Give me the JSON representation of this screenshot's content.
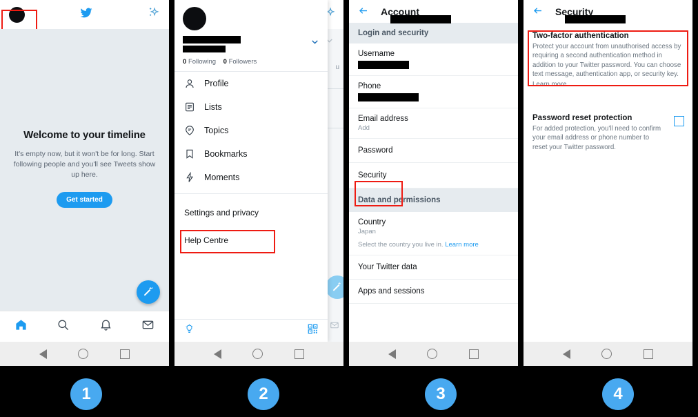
{
  "panel1": {
    "name": "twitter-timeline",
    "topbar": {
      "avatar": "avatar",
      "logo": "twitter-bird-icon",
      "sparkle": "sparkle-icon"
    },
    "empty_state": {
      "title": "Welcome to your timeline",
      "body": "It's empty now, but it won't be for long. Start following people and you'll see Tweets show up here.",
      "button": "Get started"
    },
    "tabs": [
      {
        "name": "home",
        "icon": "home-icon",
        "active": true
      },
      {
        "name": "search",
        "icon": "search-icon",
        "active": false
      },
      {
        "name": "notifications",
        "icon": "bell-icon",
        "active": false
      },
      {
        "name": "messages",
        "icon": "envelope-icon",
        "active": false
      }
    ],
    "compose": "compose-tweet-icon"
  },
  "panel2": {
    "name": "navigation-drawer",
    "profile": {
      "following_count": "0",
      "following_label": "Following",
      "followers_count": "0",
      "followers_label": "Followers"
    },
    "items": [
      {
        "label": "Profile",
        "icon": "person-icon"
      },
      {
        "label": "Lists",
        "icon": "list-icon"
      },
      {
        "label": "Topics",
        "icon": "topics-icon"
      },
      {
        "label": "Bookmarks",
        "icon": "bookmark-icon"
      },
      {
        "label": "Moments",
        "icon": "lightning-icon"
      }
    ],
    "footer_items": [
      {
        "label": "Settings and privacy",
        "highlighted": true
      },
      {
        "label": "Help Centre",
        "highlighted": false
      }
    ],
    "bottom": {
      "left_icon": "lightbulb-icon",
      "right_icon": "qr-code-icon"
    }
  },
  "panel3": {
    "name": "account-settings",
    "header": {
      "title": "Account",
      "back": "back-arrow-icon"
    },
    "sections": [
      {
        "title": "Login and security",
        "rows": [
          {
            "label": "Username",
            "value_redacted": true,
            "sub": ""
          },
          {
            "label": "Phone",
            "value_redacted": true,
            "sub": ""
          },
          {
            "label": "Email address",
            "value_redacted": false,
            "sub": "Add"
          },
          {
            "label": "Password",
            "value_redacted": false,
            "sub": ""
          },
          {
            "label": "Security",
            "value_redacted": false,
            "sub": "",
            "highlighted": true
          }
        ]
      },
      {
        "title": "Data and permissions",
        "rows": [
          {
            "label": "Country",
            "value_redacted": false,
            "sub": "Japan",
            "hint": "Select the country you live in.",
            "hint_link": "Learn more"
          },
          {
            "label": "Your Twitter data",
            "value_redacted": false,
            "sub": ""
          },
          {
            "label": "Apps and sessions",
            "value_redacted": false,
            "sub": ""
          }
        ]
      }
    ]
  },
  "panel4": {
    "name": "security-settings",
    "header": {
      "title": "Security",
      "back": "back-arrow-icon"
    },
    "rows": [
      {
        "title": "Two-factor authentication",
        "desc": "Protect your account from unauthorised access by requiring a second authentication method in addition to your Twitter password. You can choose text message, authentication app, or security key.",
        "link": "Learn more",
        "highlighted": true,
        "checkbox": false
      },
      {
        "title": "Password reset protection",
        "desc": "For added protection, you'll need to confirm your email address or phone number to reset your Twitter password.",
        "link": "",
        "highlighted": false,
        "checkbox": true
      }
    ]
  },
  "steps": [
    {
      "number": "1"
    },
    {
      "number": "2"
    },
    {
      "number": "3"
    },
    {
      "number": "4"
    }
  ],
  "colors": {
    "twitter_blue": "#1d9bf0",
    "highlight_red": "#ee1b12",
    "badge_blue": "#48a9f0",
    "timeline_bg": "#e6ebef"
  }
}
